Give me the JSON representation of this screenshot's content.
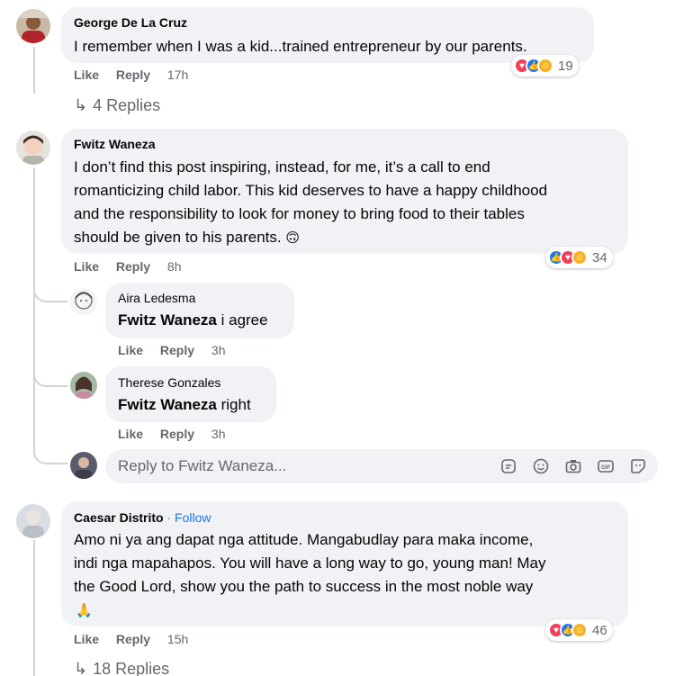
{
  "comments": [
    {
      "author": "George De La Cruz",
      "text": "I remember when I was a kid...trained entrepreneur by our parents.",
      "actions": {
        "like": "Like",
        "reply": "Reply",
        "time": "17h"
      },
      "reaction_count": "19",
      "replies_label": "4 Replies"
    },
    {
      "author": "Fwitz Waneza",
      "lines": [
        "I don’t find this post inspiring, instead, for me, it’s a call to end",
        "romanticizing child labor. This kid deserves to have a happy childhood",
        "and the responsibility to look for money to bring food to their tables",
        "should be given to his parents."
      ],
      "emoji": "🙃",
      "actions": {
        "like": "Like",
        "reply": "Reply",
        "time": "8h"
      },
      "reaction_count": "34",
      "replies": [
        {
          "author": "Aira Ledesma",
          "mention": "Fwitz Waneza",
          "text": " i agree",
          "actions": {
            "like": "Like",
            "reply": "Reply",
            "time": "3h"
          }
        },
        {
          "author": "Therese Gonzales",
          "mention": "Fwitz Waneza",
          "text": " right",
          "actions": {
            "like": "Like",
            "reply": "Reply",
            "time": "3h"
          }
        }
      ],
      "reply_input_placeholder": "Reply to Fwitz Waneza..."
    },
    {
      "author": "Caesar Distrito",
      "separator": " · ",
      "follow_label": "Follow",
      "lines": [
        "Amo ni ya ang dapat nga attitude. Mangabudlay para maka income,",
        "indi nga mapahapos. You will have a long way to go, young man! May",
        "the Good Lord, show you the path to success in the most noble way"
      ],
      "emoji": "🙏",
      "actions": {
        "like": "Like",
        "reply": "Reply",
        "time": "15h"
      },
      "reaction_count": "46",
      "replies_label": "18 Replies"
    }
  ],
  "icons": {
    "reply_arrow": "reply-arrow-icon",
    "input_tools": [
      "sticker-icon",
      "emoji-icon",
      "camera-icon",
      "gif-icon",
      "avatar-sticker-icon"
    ]
  },
  "colors": {
    "bubble": "#f0f2f5",
    "muted_text": "#65676b",
    "link": "#1877f2",
    "heart": "#f33e58",
    "like": "#1877f2",
    "care": "#f7b125"
  }
}
